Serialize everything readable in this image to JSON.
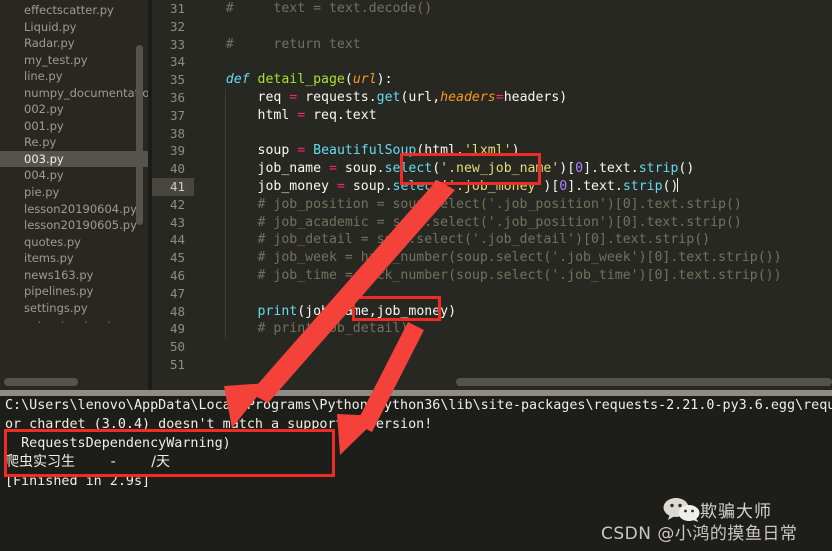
{
  "sidebar": {
    "items": [
      {
        "label": "effectscatter.py",
        "selected": false
      },
      {
        "label": "Liquid.py",
        "selected": false
      },
      {
        "label": "Radar.py",
        "selected": false
      },
      {
        "label": "my_test.py",
        "selected": false
      },
      {
        "label": "line.py",
        "selected": false
      },
      {
        "label": "numpy_documentatio",
        "selected": false
      },
      {
        "label": "002.py",
        "selected": false
      },
      {
        "label": "001.py",
        "selected": false
      },
      {
        "label": "Re.py",
        "selected": false
      },
      {
        "label": "003.py",
        "selected": true
      },
      {
        "label": "004.py",
        "selected": false
      },
      {
        "label": "pie.py",
        "selected": false
      },
      {
        "label": "lesson20190604.py",
        "selected": false
      },
      {
        "label": "lesson20190605.py",
        "selected": false
      },
      {
        "label": "quotes.py",
        "selected": false
      },
      {
        "label": "items.py",
        "selected": false
      },
      {
        "label": "news163.py",
        "selected": false
      },
      {
        "label": "pipelines.py",
        "selected": false
      },
      {
        "label": "settings.py",
        "selected": false
      }
    ]
  },
  "editor": {
    "first_line": 31,
    "last_line": 51,
    "active_line": 41,
    "line_numbers": [
      31,
      32,
      33,
      34,
      35,
      36,
      37,
      38,
      39,
      40,
      41,
      42,
      43,
      44,
      45,
      46,
      47,
      48,
      49,
      50,
      51
    ],
    "lines": [
      {
        "n": 31,
        "tokens": [
          {
            "t": "    # ",
            "c": "cm"
          },
          {
            "t": "    text = text.decode()",
            "c": "cm"
          }
        ]
      },
      {
        "n": 32,
        "tokens": []
      },
      {
        "n": 33,
        "tokens": [
          {
            "t": "    # ",
            "c": "cm"
          },
          {
            "t": "    return text",
            "c": "cm"
          }
        ]
      },
      {
        "n": 34,
        "tokens": []
      },
      {
        "n": 35,
        "tokens": [
          {
            "t": "    ",
            "c": "pl"
          },
          {
            "t": "def ",
            "c": "kw"
          },
          {
            "t": "detail_page",
            "c": "fn"
          },
          {
            "t": "(",
            "c": "pl"
          },
          {
            "t": "url",
            "c": "par"
          },
          {
            "t": "):",
            "c": "pl"
          }
        ]
      },
      {
        "n": 36,
        "tokens": [
          {
            "t": "        req ",
            "c": "pl"
          },
          {
            "t": "=",
            "c": "op"
          },
          {
            "t": " requests.",
            "c": "pl"
          },
          {
            "t": "get",
            "c": "bi"
          },
          {
            "t": "(url,",
            "c": "pl"
          },
          {
            "t": "headers",
            "c": "par"
          },
          {
            "t": "=",
            "c": "op"
          },
          {
            "t": "headers)",
            "c": "pl"
          }
        ]
      },
      {
        "n": 37,
        "tokens": [
          {
            "t": "        html ",
            "c": "pl"
          },
          {
            "t": "=",
            "c": "op"
          },
          {
            "t": " req.text",
            "c": "pl"
          }
        ]
      },
      {
        "n": 38,
        "tokens": []
      },
      {
        "n": 39,
        "tokens": [
          {
            "t": "        soup ",
            "c": "pl"
          },
          {
            "t": "=",
            "c": "op"
          },
          {
            "t": " ",
            "c": "pl"
          },
          {
            "t": "BeautifulSoup",
            "c": "cls"
          },
          {
            "t": "(html,",
            "c": "pl"
          },
          {
            "t": "'lxml'",
            "c": "str"
          },
          {
            "t": ")",
            "c": "pl"
          }
        ]
      },
      {
        "n": 40,
        "tokens": [
          {
            "t": "        job_name ",
            "c": "pl"
          },
          {
            "t": "=",
            "c": "op"
          },
          {
            "t": " soup.",
            "c": "pl"
          },
          {
            "t": "select",
            "c": "bi"
          },
          {
            "t": "(",
            "c": "pl"
          },
          {
            "t": "'.new_job_name'",
            "c": "str"
          },
          {
            "t": ")[",
            "c": "pl"
          },
          {
            "t": "0",
            "c": "num"
          },
          {
            "t": "].text.",
            "c": "pl"
          },
          {
            "t": "strip",
            "c": "bi"
          },
          {
            "t": "()",
            "c": "pl"
          }
        ]
      },
      {
        "n": 41,
        "tokens": [
          {
            "t": "        job_money ",
            "c": "pl"
          },
          {
            "t": "=",
            "c": "op"
          },
          {
            "t": " soup.",
            "c": "pl"
          },
          {
            "t": "select",
            "c": "bi"
          },
          {
            "t": "(",
            "c": "pl"
          },
          {
            "t": "'.job_money'",
            "c": "str"
          },
          {
            "t": ")[",
            "c": "pl"
          },
          {
            "t": "0",
            "c": "num"
          },
          {
            "t": "].text.",
            "c": "pl"
          },
          {
            "t": "strip",
            "c": "bi"
          },
          {
            "t": "()",
            "c": "pl"
          }
        ]
      },
      {
        "n": 42,
        "tokens": [
          {
            "t": "        # job_position = soup.select('.job_position')[0].text.strip()",
            "c": "cm"
          }
        ]
      },
      {
        "n": 43,
        "tokens": [
          {
            "t": "        # job_academic = soup.select('.job_position')[0].text.strip()",
            "c": "cm"
          }
        ]
      },
      {
        "n": 44,
        "tokens": [
          {
            "t": "        # job_detail = soup.select('.job_detail')[0].text.strip()",
            "c": "cm"
          }
        ]
      },
      {
        "n": 45,
        "tokens": [
          {
            "t": "        # job_week = hack_number(soup.select('.job_week')[0].text.strip())",
            "c": "cm"
          }
        ]
      },
      {
        "n": 46,
        "tokens": [
          {
            "t": "        # job_time = hack_number(soup.select('.job_time')[0].text.strip())",
            "c": "cm"
          }
        ]
      },
      {
        "n": 47,
        "tokens": []
      },
      {
        "n": 48,
        "tokens": [
          {
            "t": "        ",
            "c": "pl"
          },
          {
            "t": "print",
            "c": "bi"
          },
          {
            "t": "(job_name,job_money)",
            "c": "pl"
          }
        ]
      },
      {
        "n": 49,
        "tokens": [
          {
            "t": "        # print(job_detail)",
            "c": "cm"
          }
        ]
      },
      {
        "n": 50,
        "tokens": []
      },
      {
        "n": 51,
        "tokens": []
      }
    ]
  },
  "console": {
    "lines": [
      {
        "text": "C:\\Users\\lenovo\\AppData\\Local\\Programs\\Python\\Python36\\lib\\site-packages\\requests-2.21.0-py3.6.egg\\requ",
        "cjk": false
      },
      {
        "text": "or chardet (3.0.4) doesn't match a supported version!",
        "cjk": false
      },
      {
        "text": "  RequestsDependencyWarning)",
        "cjk": false
      },
      {
        "text": "爬虫实习生        -        /天",
        "cjk": true
      },
      {
        "text": "[Finished in 2.9s]",
        "cjk": false
      }
    ]
  },
  "annotations": {
    "accent_color": "#ee2b24",
    "boxes": [
      {
        "name": "select-call-box",
        "target": "soup.select('.new_job_name') / soup.select('.job_money')"
      },
      {
        "name": "print-args-box",
        "target": "job_money)"
      },
      {
        "name": "console-output-box",
        "target": "爬虫实习生 - /天"
      }
    ],
    "arrows": [
      {
        "name": "arrow-select-to-output",
        "from": "select-call-box",
        "to": "console-output-line"
      },
      {
        "name": "arrow-print-to-output",
        "from": "print-args-box",
        "to": "console-output-line"
      }
    ]
  },
  "watermark": {
    "brand": "欺骗大师",
    "csdn": "CSDN @小鸿的摸鱼日常",
    "icon": "wechat-icon"
  },
  "colors": {
    "editor_bg": "#272822",
    "sidebar_bg": "#2a2723",
    "console_bg": "#1d1e19",
    "divider": "#8e8c84",
    "selection": "#55534d",
    "active_line": "#494640",
    "annotation_red": "#ee2b24",
    "comment": "#75715e",
    "string": "#e6db74",
    "keyword": "#66d9ef",
    "function": "#a6e22e",
    "operator": "#f92672",
    "number": "#ae81ff"
  }
}
